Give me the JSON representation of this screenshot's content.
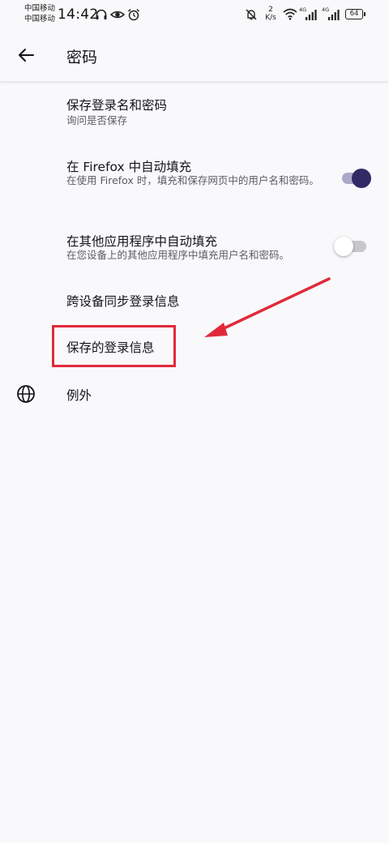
{
  "status_bar": {
    "carrier_1": "中国移动",
    "carrier_2": "中国移动",
    "time": "14:42",
    "speed_value": "2",
    "speed_unit": "K/s",
    "network_1": "4G",
    "network_2": "4G",
    "battery": "64",
    "icons": [
      "headphones-icon",
      "eye-icon",
      "alarm-icon",
      "mute-bell-icon",
      "wifi-icon",
      "signal-icon",
      "battery-icon"
    ]
  },
  "app_bar": {
    "title": "密码",
    "back_icon": "arrow-left-icon"
  },
  "preferences": {
    "save_logins": {
      "title": "保存登录名和密码",
      "summary": "询问是否保存"
    },
    "autofill_firefox": {
      "title": "在 Firefox 中自动填充",
      "summary": "在使用 Firefox 时，填充和保存网页中的用户名和密码。",
      "enabled": true
    },
    "autofill_other_apps": {
      "title": "在其他应用程序中自动填充",
      "summary": "在您设备上的其他应用程序中填充用户名和密码。",
      "enabled": false
    },
    "sync_logins": {
      "title": "跨设备同步登录信息"
    },
    "saved_logins": {
      "title": "保存的登录信息"
    },
    "exceptions": {
      "title": "例外",
      "icon": "globe-icon"
    }
  },
  "annotation": {
    "highlight_color": "#e02a3a"
  },
  "colors": {
    "background": "#f9f9fb",
    "text_primary": "#15141a",
    "text_secondary": "#5b5b66",
    "switch_on_thumb": "#312a65",
    "switch_on_track": "#aaa9c7"
  }
}
